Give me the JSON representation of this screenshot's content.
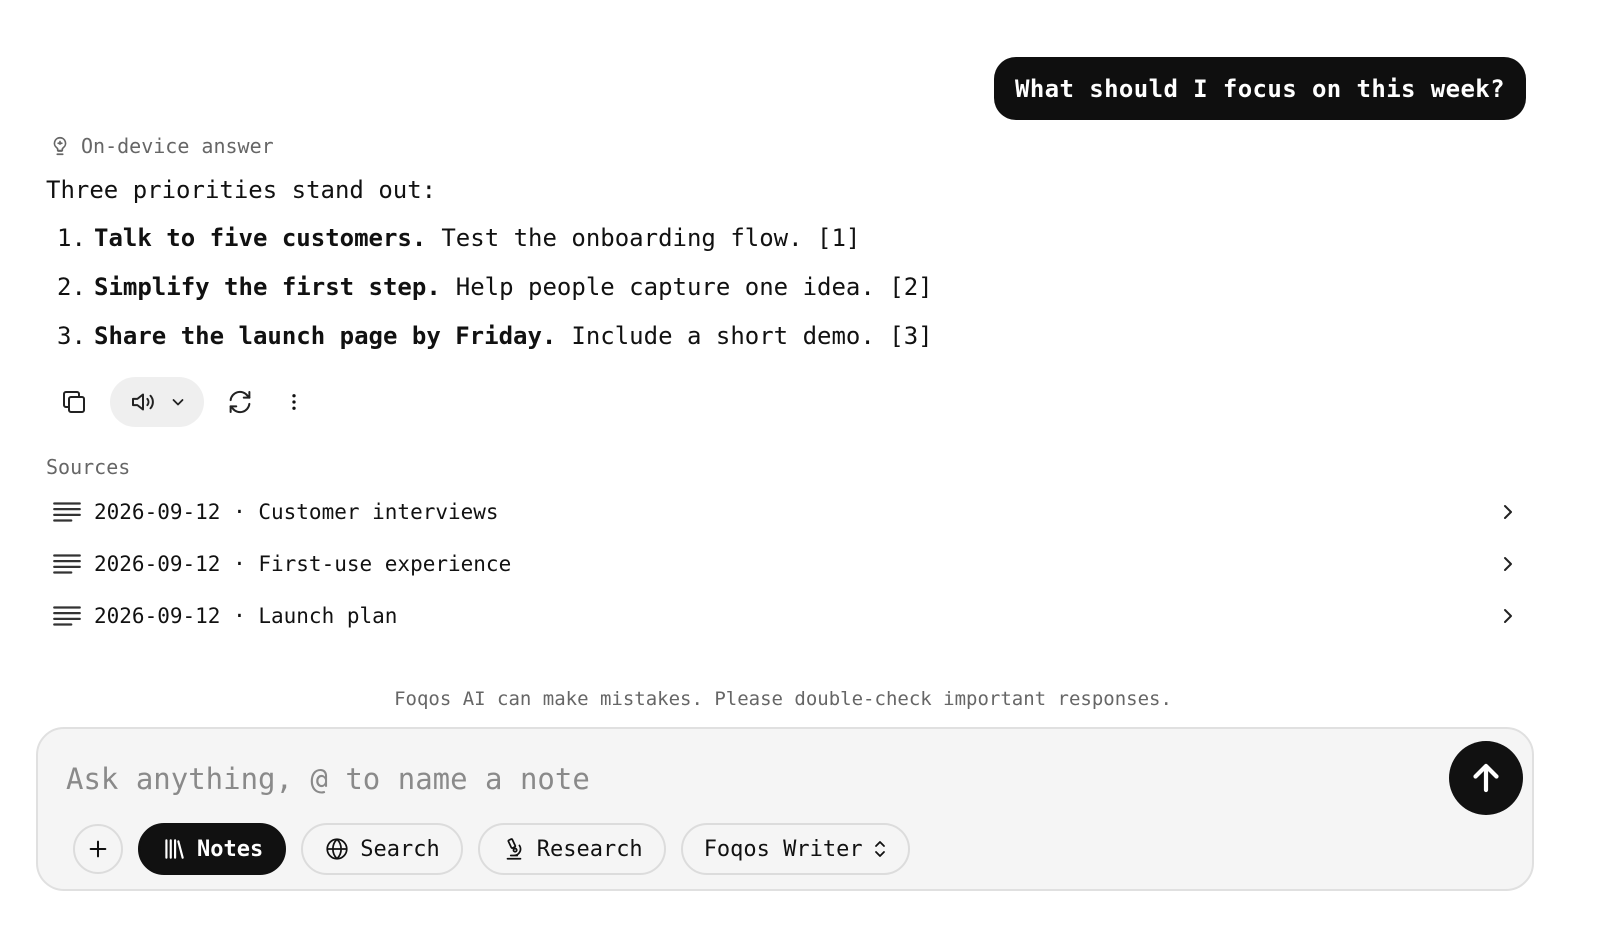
{
  "conversation": {
    "user_message": "What should I focus on this week?",
    "answer_badge": "On-device answer",
    "intro": "Three priorities stand out:",
    "priorities": [
      {
        "number": "1.",
        "bold": "Talk to five customers.",
        "rest": "Test the onboarding flow. [1]"
      },
      {
        "number": "2.",
        "bold": "Simplify the first step.",
        "rest": "Help people capture one idea. [2]"
      },
      {
        "number": "3.",
        "bold": "Share the launch page by Friday.",
        "rest": "Include a short demo. [3]"
      }
    ]
  },
  "actions": {
    "icons": [
      "copy-icon",
      "speaker-icon",
      "chevron-down-icon",
      "refresh-icon",
      "more-vertical-icon"
    ]
  },
  "sources": {
    "label": "Sources",
    "items": [
      {
        "label": "2026-09-12 · Customer interviews"
      },
      {
        "label": "2026-09-12 · First-use experience"
      },
      {
        "label": "2026-09-12 · Launch plan"
      }
    ]
  },
  "disclaimer": "Foqos AI can make mistakes. Please double-check important responses.",
  "composer": {
    "placeholder": "Ask anything, @ to name a note",
    "value": "",
    "chips": {
      "notes": "Notes",
      "search": "Search",
      "research": "Research",
      "model": "Foqos Writer"
    },
    "active_chip": "notes"
  },
  "colors": {
    "bubble_bg": "#0f0f0f",
    "active_chip_bg": "#111111",
    "composer_bg": "#f5f5f5",
    "muted_text": "#666666"
  }
}
